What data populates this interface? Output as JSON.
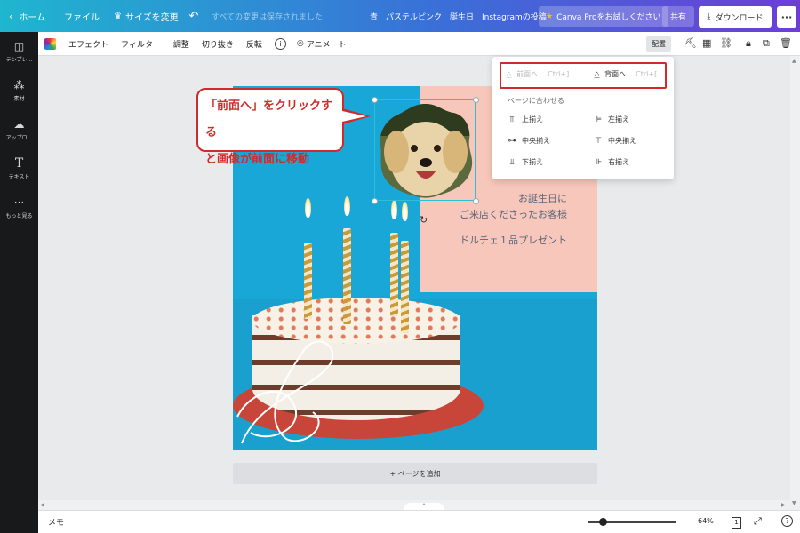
{
  "topbar": {
    "home": "ホーム",
    "file": "ファイル",
    "resize": "サイズを変更",
    "saved": "すべての変更は保存されました",
    "title": "青　パステルピンク　誕生日　Instagramの投稿",
    "pro": "Canva Proをお試しください",
    "share": "共有",
    "download": "ダウンロード",
    "more": "···"
  },
  "sidebar": {
    "items": [
      {
        "label": "テンプレ...",
        "icon": "template-icon"
      },
      {
        "label": "素材",
        "icon": "elements-icon"
      },
      {
        "label": "アップロ...",
        "icon": "upload-icon"
      },
      {
        "label": "テキスト",
        "icon": "text-icon"
      },
      {
        "label": "もっと見る",
        "icon": "more-icon"
      }
    ]
  },
  "toolbar": {
    "effect": "エフェクト",
    "filter": "フィルター",
    "adjust": "調整",
    "crop": "切り抜き",
    "flip": "反転",
    "info": "i",
    "animate": "アニメート",
    "arrange": "配置"
  },
  "design": {
    "text_line1": "お誕生日に",
    "text_line2": "ご来店くださったお客様",
    "text_line3": "ドルチェ１品プレゼント"
  },
  "callout": {
    "line1": "「前面へ」をクリックする",
    "line2": "と画像が前面に移動"
  },
  "arrange_menu": {
    "front": "前面へ",
    "front_shortcut": "Ctrl+]",
    "back": "背面へ",
    "back_shortcut": "Ctrl+[",
    "section": "ページに合わせる",
    "align_top": "上揃え",
    "align_left": "左揃え",
    "align_middle": "中央揃え",
    "align_center": "中央揃え",
    "align_bottom": "下揃え",
    "align_right": "右揃え"
  },
  "add_page": "+ ページを追加",
  "bottombar": {
    "memo": "メモ",
    "zoom": "64%",
    "zoom_value": 0.64,
    "page_count": "1",
    "help": "?"
  },
  "colors": {
    "topbar_start": "#1fb6cf",
    "topbar_end": "#6c3ed6",
    "highlight_red": "#d22a2a",
    "design_blue": "#19a7d8",
    "design_pink": "#f7c7bb"
  }
}
